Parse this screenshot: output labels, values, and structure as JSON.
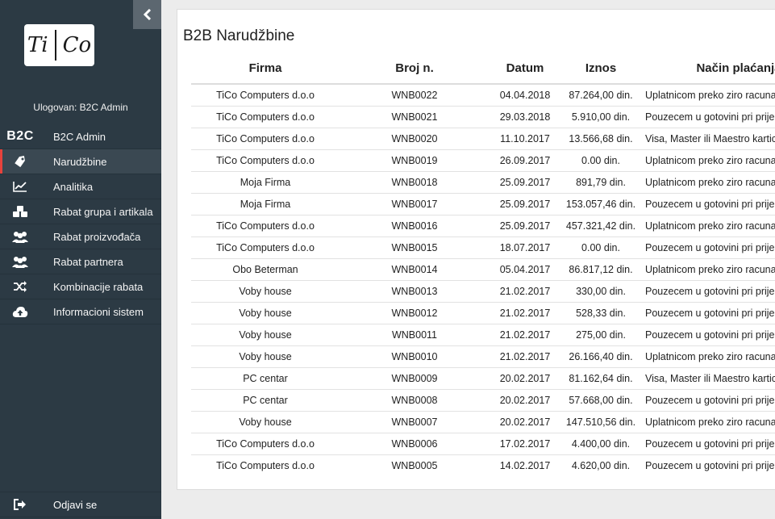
{
  "sidebar": {
    "logo_text_left": "Ti",
    "logo_text_right": "Co",
    "logged_in": "Ulogovan: B2C Admin",
    "items": [
      {
        "label": "B2C Admin",
        "icon": "b2c-text-icon",
        "icon_text": "B2C"
      },
      {
        "label": "Narudžbine",
        "icon": "tag-icon",
        "active": true
      },
      {
        "label": "Analitika",
        "icon": "line-chart-icon"
      },
      {
        "label": "Rabat grupa i artikala",
        "icon": "cubes-icon"
      },
      {
        "label": "Rabat proizvođača",
        "icon": "users-icon"
      },
      {
        "label": "Rabat partnera",
        "icon": "users-icon"
      },
      {
        "label": "Kombinacije rabata",
        "icon": "shuffle-icon"
      },
      {
        "label": "Informacioni sistem",
        "icon": "cloud-upload-icon"
      }
    ],
    "logout_label": "Odjavi se"
  },
  "main": {
    "title": "B2B Narudžbine",
    "columns": [
      "Firma",
      "Broj n.",
      "Datum",
      "Iznos",
      "Način plaćanja"
    ],
    "rows": [
      [
        "TiCo Computers d.o.o",
        "WNB0022",
        "04.04.2018",
        "87.264,00 din.",
        "Uplatnicom preko ziro racuna"
      ],
      [
        "TiCo Computers d.o.o",
        "WNB0021",
        "29.03.2018",
        "5.910,00 din.",
        "Pouzecem u gotovini pri prijemu"
      ],
      [
        "TiCo Computers d.o.o",
        "WNB0020",
        "11.10.2017",
        "13.566,68 din.",
        "Visa, Master ili Maestro karticom"
      ],
      [
        "TiCo Computers d.o.o",
        "WNB0019",
        "26.09.2017",
        "0.00 din.",
        "Uplatnicom preko ziro racuna"
      ],
      [
        "Moja Firma",
        "WNB0018",
        "25.09.2017",
        "891,79 din.",
        "Uplatnicom preko ziro racuna"
      ],
      [
        "Moja Firma",
        "WNB0017",
        "25.09.2017",
        "153.057,46 din.",
        "Pouzecem u gotovini pri prijemu"
      ],
      [
        "TiCo Computers d.o.o",
        "WNB0016",
        "25.09.2017",
        "457.321,42 din.",
        "Uplatnicom preko ziro racuna"
      ],
      [
        "TiCo Computers d.o.o",
        "WNB0015",
        "18.07.2017",
        "0.00 din.",
        "Pouzecem u gotovini pri prijemu"
      ],
      [
        "Obo Beterman",
        "WNB0014",
        "05.04.2017",
        "86.817,12 din.",
        "Uplatnicom preko ziro racuna"
      ],
      [
        "Voby house",
        "WNB0013",
        "21.02.2017",
        "330,00 din.",
        "Pouzecem u gotovini pri prijemu"
      ],
      [
        "Voby house",
        "WNB0012",
        "21.02.2017",
        "528,33 din.",
        "Pouzecem u gotovini pri prijemu"
      ],
      [
        "Voby house",
        "WNB0011",
        "21.02.2017",
        "275,00 din.",
        "Pouzecem u gotovini pri prijemu"
      ],
      [
        "Voby house",
        "WNB0010",
        "21.02.2017",
        "26.166,40 din.",
        "Uplatnicom preko ziro racuna"
      ],
      [
        "PC centar",
        "WNB0009",
        "20.02.2017",
        "81.162,64 din.",
        "Visa, Master ili Maestro karticom"
      ],
      [
        "PC centar",
        "WNB0008",
        "20.02.2017",
        "57.668,00 din.",
        "Pouzecem u gotovini pri prijemu"
      ],
      [
        "Voby house",
        "WNB0007",
        "20.02.2017",
        "147.510,56 din.",
        "Uplatnicom preko ziro racuna"
      ],
      [
        "TiCo Computers d.o.o",
        "WNB0006",
        "17.02.2017",
        "4.400,00 din.",
        "Pouzecem u gotovini pri prijemu"
      ],
      [
        "TiCo Computers d.o.o",
        "WNB0005",
        "14.02.2017",
        "4.620,00 din.",
        "Pouzecem u gotovini pri prijemu"
      ]
    ]
  },
  "colors": {
    "sidebar_bg": "#2c3a44",
    "active_marker": "#e7423c",
    "page_bg": "#ececec"
  }
}
